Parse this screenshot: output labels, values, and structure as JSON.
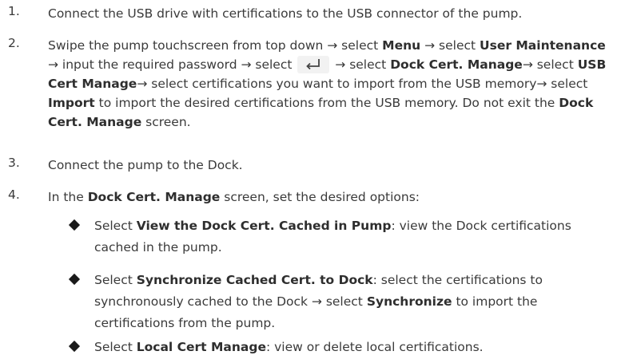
{
  "steps": [
    {
      "number": "1.",
      "text": "Connect the USB drive with certifications to the USB connector of the pump."
    },
    {
      "number": "2.",
      "parts": {
        "p1": "Swipe the pump touchscreen from top down → select ",
        "b1": "Menu",
        "p2": " → select ",
        "b2": "User Maintenance",
        "p3": " → input the required password → select ",
        "icon": "enter-icon",
        "p4": " → select ",
        "b3": "Dock Cert. Manage",
        "p5": "→ select ",
        "b4": "USB Cert Manage",
        "p6": "→ select certifications you want to import from the USB memory→ select ",
        "b5": "Import",
        "p7": " to import the desired certifications from the USB memory. Do not exit the ",
        "b6": "Dock Cert. Manage",
        "p8": " screen."
      }
    },
    {
      "number": "3.",
      "text": "Connect the pump to the Dock."
    },
    {
      "number": "4.",
      "parts": {
        "p1": "In the ",
        "b1": "Dock Cert. Manage",
        "p2": " screen, set the desired options:"
      }
    }
  ],
  "bullets": [
    {
      "pre": "Select ",
      "bold": "View the Dock Cert. Cached in Pump",
      "post": ": view the Dock certifications cached in the pump."
    },
    {
      "pre": "Select ",
      "bold": "Synchronize Cached Cert. to Dock",
      "post": ": select the certifications to synchronously cached to the Dock → select ",
      "bold2": "Synchronize",
      "post2": " to import the certifications from the pump."
    },
    {
      "pre": "Select ",
      "bold": "Local Cert Manage",
      "post": ": view or delete local certifications."
    }
  ]
}
